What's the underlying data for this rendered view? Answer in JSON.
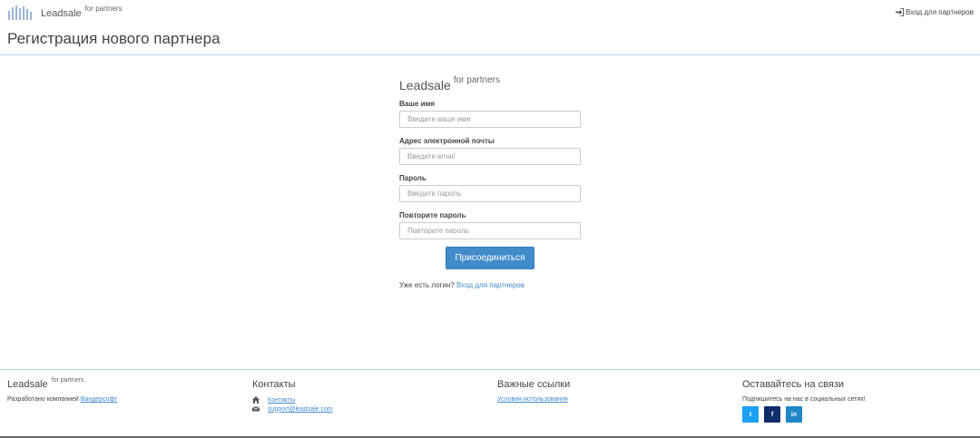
{
  "header": {
    "brand": "Leadsale",
    "brand_sup": "for partners",
    "login_link": "Вход для партнеров",
    "logo_icon": "leadsale-bars-logo",
    "login_icon": "sign-in-icon"
  },
  "page": {
    "title": "Регистрация нового партнера"
  },
  "form": {
    "brand": "Leadsale",
    "brand_sup": "for partners",
    "fields": [
      {
        "label": "Ваше имя",
        "placeholder": "Введите ваше имя",
        "value": ""
      },
      {
        "label": "Адрес электронной почты",
        "placeholder": "Введите email",
        "value": ""
      },
      {
        "label": "Пароль",
        "placeholder": "Введите пароль",
        "value": ""
      },
      {
        "label": "Повторите пароль",
        "placeholder": "Повторите пароль",
        "value": ""
      }
    ],
    "submit_label": "Присоединиться",
    "already_text": "Уже есть логин?",
    "already_link": "Вход для партнеров"
  },
  "footer": {
    "col1": {
      "brand": "Leadsale",
      "brand_sup": "for partners",
      "developed_text": "Разработано компанией",
      "developer_link": "Вандерсофт"
    },
    "col2": {
      "title": "Контакты",
      "contacts_link": "Контакты",
      "email": "support@leadsale.com",
      "home_icon": "home-icon",
      "mail_icon": "envelope-icon"
    },
    "col3": {
      "title": "Важные ссылки",
      "terms_link": "Условия использования"
    },
    "col4": {
      "title": "Оставайтесь на связи",
      "subscribe_text": "Подпишитесь на нас в социальных сетях!",
      "socials": [
        {
          "name": "twitter",
          "glyph": "t",
          "color": "#1da1f2"
        },
        {
          "name": "facebook",
          "glyph": "f",
          "color": "#0f2c6b"
        },
        {
          "name": "linkedin",
          "glyph": "in",
          "color": "#1f86c8"
        }
      ]
    }
  },
  "colors": {
    "primary": "#428bca",
    "rule": "#b9d3ec"
  }
}
